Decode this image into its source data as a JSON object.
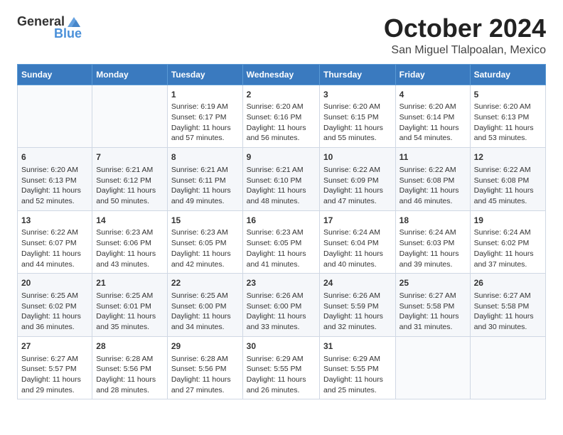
{
  "header": {
    "logo_general": "General",
    "logo_blue": "Blue",
    "month": "October 2024",
    "location": "San Miguel Tlalpoalan, Mexico"
  },
  "days_of_week": [
    "Sunday",
    "Monday",
    "Tuesday",
    "Wednesday",
    "Thursday",
    "Friday",
    "Saturday"
  ],
  "weeks": [
    [
      {
        "day": "",
        "info": ""
      },
      {
        "day": "",
        "info": ""
      },
      {
        "day": "1",
        "info": "Sunrise: 6:19 AM\nSunset: 6:17 PM\nDaylight: 11 hours and 57 minutes."
      },
      {
        "day": "2",
        "info": "Sunrise: 6:20 AM\nSunset: 6:16 PM\nDaylight: 11 hours and 56 minutes."
      },
      {
        "day": "3",
        "info": "Sunrise: 6:20 AM\nSunset: 6:15 PM\nDaylight: 11 hours and 55 minutes."
      },
      {
        "day": "4",
        "info": "Sunrise: 6:20 AM\nSunset: 6:14 PM\nDaylight: 11 hours and 54 minutes."
      },
      {
        "day": "5",
        "info": "Sunrise: 6:20 AM\nSunset: 6:13 PM\nDaylight: 11 hours and 53 minutes."
      }
    ],
    [
      {
        "day": "6",
        "info": "Sunrise: 6:20 AM\nSunset: 6:13 PM\nDaylight: 11 hours and 52 minutes."
      },
      {
        "day": "7",
        "info": "Sunrise: 6:21 AM\nSunset: 6:12 PM\nDaylight: 11 hours and 50 minutes."
      },
      {
        "day": "8",
        "info": "Sunrise: 6:21 AM\nSunset: 6:11 PM\nDaylight: 11 hours and 49 minutes."
      },
      {
        "day": "9",
        "info": "Sunrise: 6:21 AM\nSunset: 6:10 PM\nDaylight: 11 hours and 48 minutes."
      },
      {
        "day": "10",
        "info": "Sunrise: 6:22 AM\nSunset: 6:09 PM\nDaylight: 11 hours and 47 minutes."
      },
      {
        "day": "11",
        "info": "Sunrise: 6:22 AM\nSunset: 6:08 PM\nDaylight: 11 hours and 46 minutes."
      },
      {
        "day": "12",
        "info": "Sunrise: 6:22 AM\nSunset: 6:08 PM\nDaylight: 11 hours and 45 minutes."
      }
    ],
    [
      {
        "day": "13",
        "info": "Sunrise: 6:22 AM\nSunset: 6:07 PM\nDaylight: 11 hours and 44 minutes."
      },
      {
        "day": "14",
        "info": "Sunrise: 6:23 AM\nSunset: 6:06 PM\nDaylight: 11 hours and 43 minutes."
      },
      {
        "day": "15",
        "info": "Sunrise: 6:23 AM\nSunset: 6:05 PM\nDaylight: 11 hours and 42 minutes."
      },
      {
        "day": "16",
        "info": "Sunrise: 6:23 AM\nSunset: 6:05 PM\nDaylight: 11 hours and 41 minutes."
      },
      {
        "day": "17",
        "info": "Sunrise: 6:24 AM\nSunset: 6:04 PM\nDaylight: 11 hours and 40 minutes."
      },
      {
        "day": "18",
        "info": "Sunrise: 6:24 AM\nSunset: 6:03 PM\nDaylight: 11 hours and 39 minutes."
      },
      {
        "day": "19",
        "info": "Sunrise: 6:24 AM\nSunset: 6:02 PM\nDaylight: 11 hours and 37 minutes."
      }
    ],
    [
      {
        "day": "20",
        "info": "Sunrise: 6:25 AM\nSunset: 6:02 PM\nDaylight: 11 hours and 36 minutes."
      },
      {
        "day": "21",
        "info": "Sunrise: 6:25 AM\nSunset: 6:01 PM\nDaylight: 11 hours and 35 minutes."
      },
      {
        "day": "22",
        "info": "Sunrise: 6:25 AM\nSunset: 6:00 PM\nDaylight: 11 hours and 34 minutes."
      },
      {
        "day": "23",
        "info": "Sunrise: 6:26 AM\nSunset: 6:00 PM\nDaylight: 11 hours and 33 minutes."
      },
      {
        "day": "24",
        "info": "Sunrise: 6:26 AM\nSunset: 5:59 PM\nDaylight: 11 hours and 32 minutes."
      },
      {
        "day": "25",
        "info": "Sunrise: 6:27 AM\nSunset: 5:58 PM\nDaylight: 11 hours and 31 minutes."
      },
      {
        "day": "26",
        "info": "Sunrise: 6:27 AM\nSunset: 5:58 PM\nDaylight: 11 hours and 30 minutes."
      }
    ],
    [
      {
        "day": "27",
        "info": "Sunrise: 6:27 AM\nSunset: 5:57 PM\nDaylight: 11 hours and 29 minutes."
      },
      {
        "day": "28",
        "info": "Sunrise: 6:28 AM\nSunset: 5:56 PM\nDaylight: 11 hours and 28 minutes."
      },
      {
        "day": "29",
        "info": "Sunrise: 6:28 AM\nSunset: 5:56 PM\nDaylight: 11 hours and 27 minutes."
      },
      {
        "day": "30",
        "info": "Sunrise: 6:29 AM\nSunset: 5:55 PM\nDaylight: 11 hours and 26 minutes."
      },
      {
        "day": "31",
        "info": "Sunrise: 6:29 AM\nSunset: 5:55 PM\nDaylight: 11 hours and 25 minutes."
      },
      {
        "day": "",
        "info": ""
      },
      {
        "day": "",
        "info": ""
      }
    ]
  ]
}
